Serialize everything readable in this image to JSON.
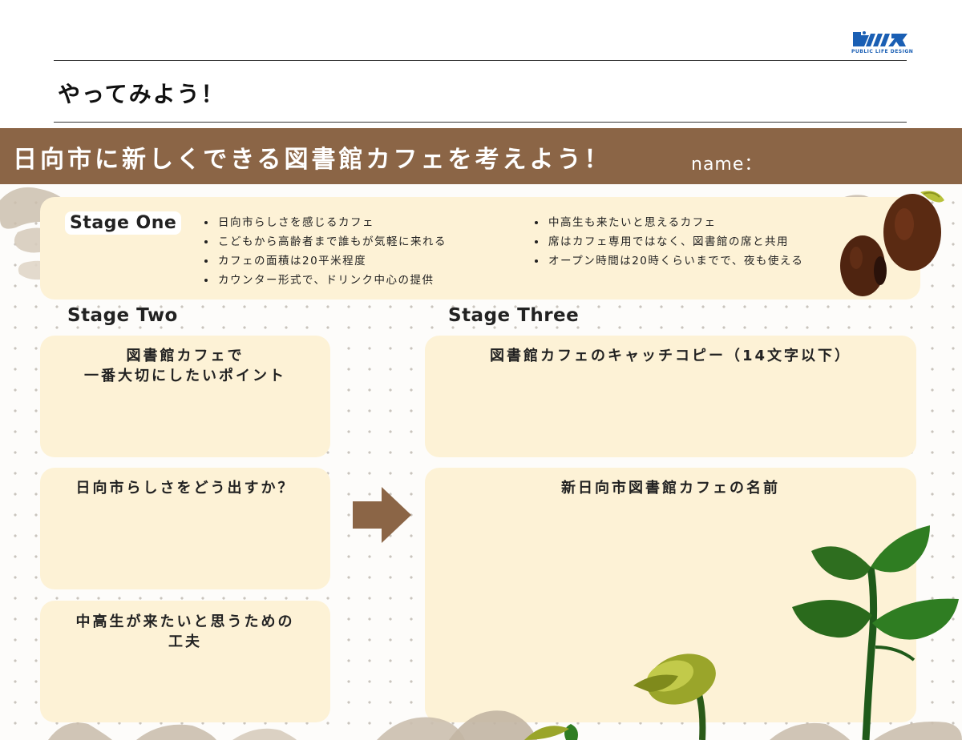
{
  "logo": {
    "mark": "ﾍﾟﾘﾏ",
    "subtitle": "PUBLIC LIFE DESIGN"
  },
  "heading": "やってみよう！",
  "banner": {
    "title": "日向市に新しくできる図書館カフェを考えよう！",
    "name_label": "name："
  },
  "stage_one": {
    "label": "Stage One",
    "left_items": [
      "日向市らしさを感じるカフェ",
      "こどもから高齢者まで誰もが気軽に来れる",
      "カフェの面積は20平米程度",
      "カウンター形式で、ドリンク中心の提供"
    ],
    "right_items": [
      "中高生も来たいと思えるカフェ",
      "席はカフェ専用ではなく、図書館の席と共用",
      "オープン時間は20時くらいまでで、夜も使える"
    ]
  },
  "stage_two": {
    "label": "Stage Two",
    "boxes": [
      {
        "title": "図書館カフェで\n一番大切にしたいポイント"
      },
      {
        "title": "日向市らしさをどう出すか？"
      },
      {
        "title": "中高生が来たいと思うための\n工夫"
      }
    ]
  },
  "stage_three": {
    "label": "Stage Three",
    "boxes": [
      {
        "title": "図書館カフェのキャッチコピー（14文字以下）"
      },
      {
        "title": "新日向市図書館カフェの名前"
      }
    ]
  },
  "colors": {
    "banner": "#8b6546",
    "panel": "#fdf2d6",
    "arrow": "#8b6546",
    "logo": "#1a5fb4"
  }
}
